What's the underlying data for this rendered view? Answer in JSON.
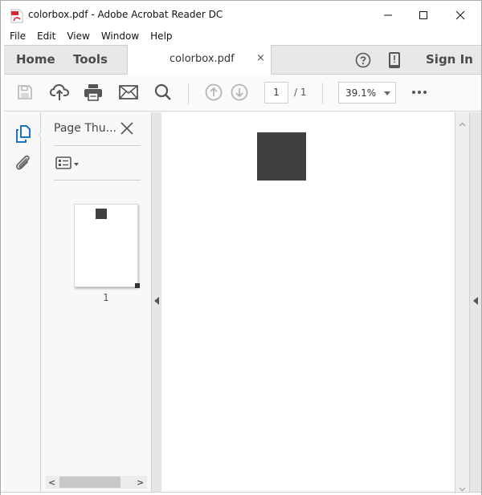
{
  "window": {
    "title": "colorbox.pdf - Adobe Acrobat Reader DC",
    "app_icon": "pdf-icon",
    "controls": {
      "minimize": "minimize-icon",
      "maximize": "maximize-icon",
      "close": "close-icon"
    }
  },
  "menu": {
    "items": [
      {
        "label": "File"
      },
      {
        "label": "Edit"
      },
      {
        "label": "View"
      },
      {
        "label": "Window"
      },
      {
        "label": "Help"
      }
    ]
  },
  "tabs": {
    "home": "Home",
    "tools": "Tools",
    "document": "colorbox.pdf",
    "document_close": "×",
    "sign_in": "Sign In"
  },
  "toolbar": {
    "icons": [
      "save-icon",
      "upload-cloud-icon",
      "print-icon",
      "email-icon",
      "search-icon",
      "previous-page-icon",
      "next-page-icon",
      "more-icon"
    ],
    "page_current": "1",
    "page_total": "/  1",
    "zoom_level": "39.1%"
  },
  "sidebar": {
    "rail_icons": [
      "page-thumbnails-icon",
      "attachments-icon"
    ],
    "panel_title": "Page Thu...",
    "thumbnails": [
      {
        "label": "1"
      }
    ],
    "scroll_left": "<",
    "scroll_right": ">"
  },
  "document": {
    "content": "colored-square",
    "box_color": "#404040"
  },
  "colors": {
    "accent": "#1c73c4",
    "pdf_red": "#d7262e",
    "tabbar_bg": "#e8e8e8",
    "toolbar_bg": "#fafafa"
  }
}
